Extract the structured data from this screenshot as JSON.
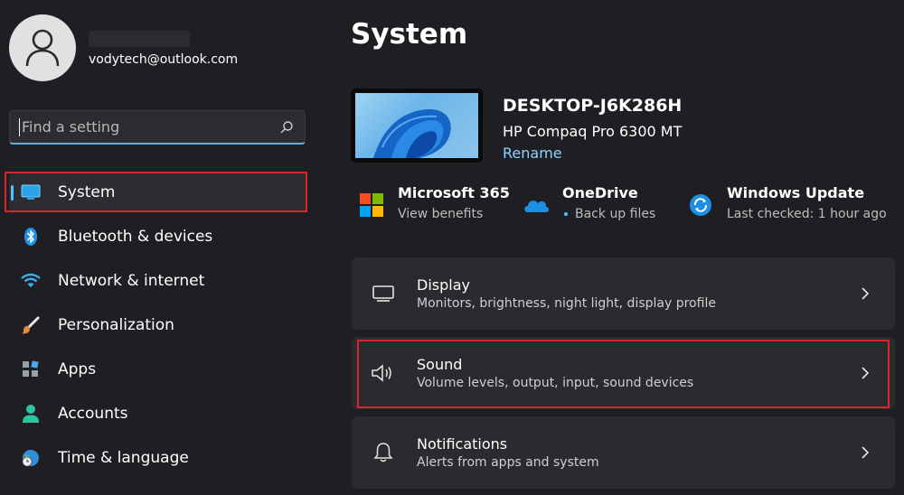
{
  "account": {
    "email": "vodytech@outlook.com"
  },
  "search": {
    "placeholder": "Find a setting"
  },
  "sidebar": {
    "items": [
      {
        "label": "System",
        "icon": "monitor-icon"
      },
      {
        "label": "Bluetooth & devices",
        "icon": "bluetooth-icon"
      },
      {
        "label": "Network & internet",
        "icon": "wifi-icon"
      },
      {
        "label": "Personalization",
        "icon": "brush-icon"
      },
      {
        "label": "Apps",
        "icon": "apps-icon"
      },
      {
        "label": "Accounts",
        "icon": "person-icon"
      },
      {
        "label": "Time & language",
        "icon": "globe-clock-icon"
      }
    ],
    "selected": "System"
  },
  "main": {
    "title": "System",
    "device": {
      "name": "DESKTOP-J6K286H",
      "model": "HP Compaq Pro 6300 MT",
      "rename_label": "Rename"
    },
    "quick": [
      {
        "title": "Microsoft 365",
        "subtitle": "View benefits",
        "icon": "microsoft-logo-icon"
      },
      {
        "title": "OneDrive",
        "subtitle": "Back up files",
        "icon": "onedrive-cloud-icon"
      },
      {
        "title": "Windows Update",
        "subtitle": "Last checked: 1 hour ago",
        "icon": "windows-update-icon"
      }
    ],
    "cards": [
      {
        "title": "Display",
        "subtitle": "Monitors, brightness, night light, display profile",
        "icon": "display-icon"
      },
      {
        "title": "Sound",
        "subtitle": "Volume levels, output, input, sound devices",
        "icon": "speaker-icon"
      },
      {
        "title": "Notifications",
        "subtitle": "Alerts from apps and system",
        "icon": "bell-icon"
      }
    ]
  },
  "colors": {
    "background": "#1f1f23",
    "card": "#2b2b2f",
    "accent": "#4cc2ff",
    "link": "#8fd2ff",
    "highlight_box": "#d9262b"
  }
}
